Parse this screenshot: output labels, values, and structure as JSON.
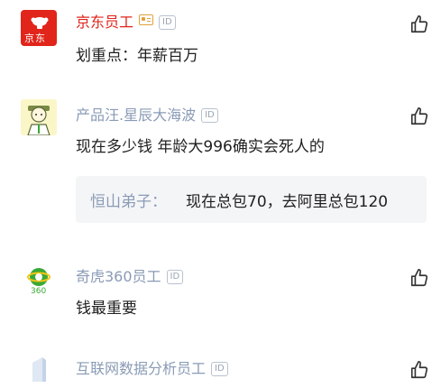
{
  "comments": [
    {
      "username": "京东员工",
      "badge_id": "ID",
      "badge_icon": "company-card-icon",
      "text": "划重点：年薪百万",
      "avatar": "jd-logo-icon",
      "avatar_text": "京东"
    },
    {
      "username": "产品汪.星辰大海波",
      "badge_id": "ID",
      "text": "现在多少钱 年龄大996确实会死人的",
      "avatar": "cartoon-person-avatar",
      "reply": {
        "name": "恒山弟子：",
        "text": "现在总包70，去阿里总包120"
      }
    },
    {
      "username": "奇虎360员工",
      "badge_id": "ID",
      "text": "钱最重要",
      "avatar": "360-logo-icon",
      "avatar_text": "360"
    },
    {
      "username": "互联网数据分析员工",
      "badge_id": "ID",
      "text": "",
      "avatar": "building-icon"
    }
  ],
  "like_icon": "thumbs-up-icon",
  "colors": {
    "username": "#8a9bb6",
    "content": "#1f1f1f",
    "jd_red": "#e1251b",
    "badge_gold": "#e0a13a",
    "reply_bg": "#f4f5f7",
    "logo_green": "#3aa935"
  }
}
